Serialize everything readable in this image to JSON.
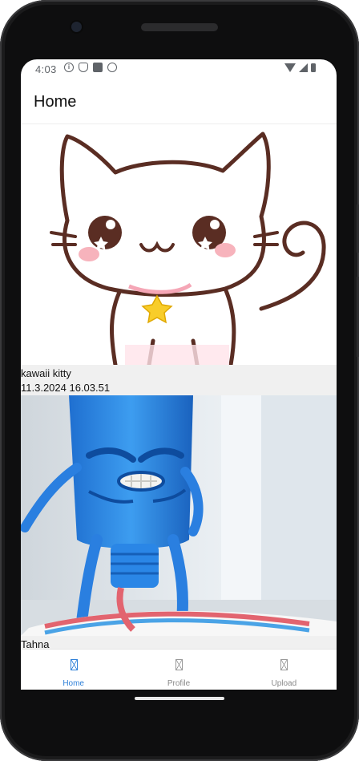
{
  "status_bar": {
    "time": "4:03",
    "icons": [
      "info-icon",
      "shield-icon",
      "sd-card-icon",
      "android-icon"
    ],
    "right_icons": [
      "wifi-icon",
      "cell-signal-icon",
      "battery-icon"
    ]
  },
  "app_bar": {
    "title": "Home"
  },
  "feed": {
    "posts": [
      {
        "caption": "kawaii kitty",
        "timestamp": "11.3.2024 16.03.51",
        "image": "kawaii-kitty-illustration"
      },
      {
        "caption": "Tahna",
        "timestamp": "",
        "image": "angry-toothpaste-tube-photo"
      }
    ]
  },
  "tab_bar": {
    "tabs": [
      {
        "label": "Home",
        "active": true
      },
      {
        "label": "Profile",
        "active": false
      },
      {
        "label": "Upload",
        "active": false
      }
    ]
  },
  "colors": {
    "accent": "#2f80d8",
    "meta_bg": "#f0f0f0",
    "frame": "#0e0e0f"
  }
}
